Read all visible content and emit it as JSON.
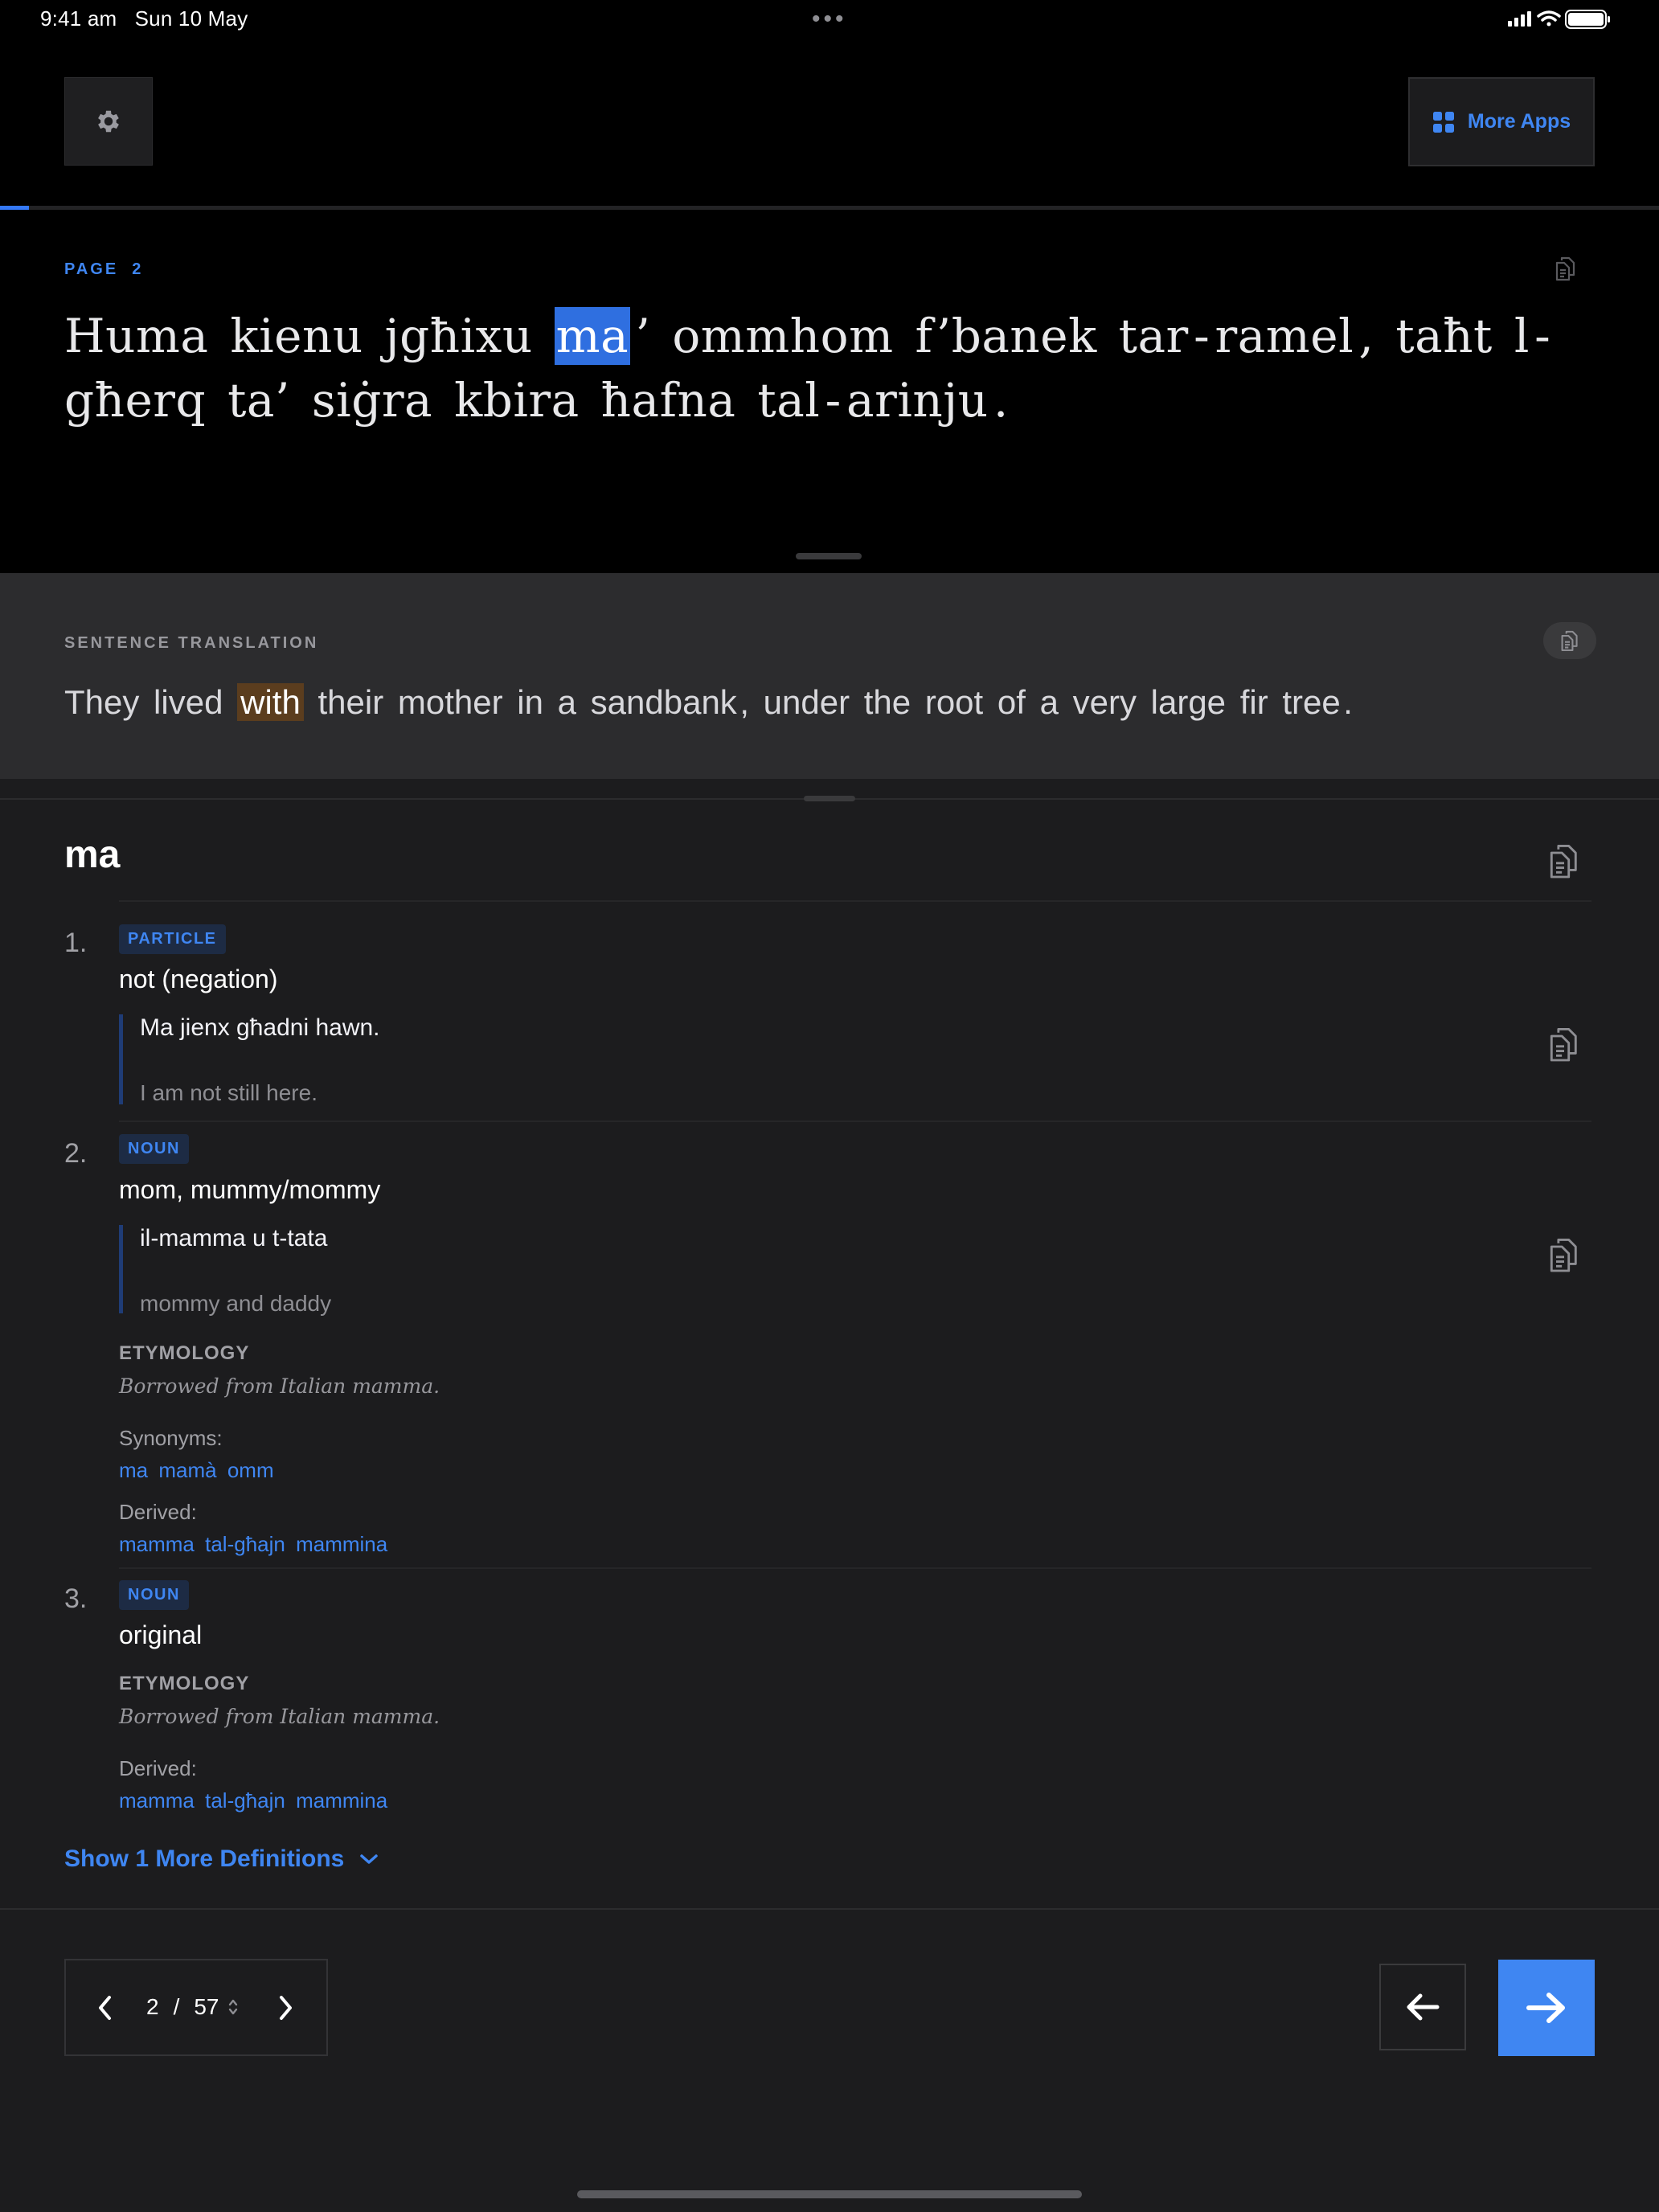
{
  "status_bar": {
    "time": "9:41 am",
    "date": "Sun 10 May",
    "dots": "•••"
  },
  "toolbar": {
    "more_apps_label": "More Apps"
  },
  "reader": {
    "page_label": "PAGE  2",
    "sentence_words": [
      "Huma",
      "kienu",
      "jgħixu",
      "ma",
      "’",
      "ommhom",
      "f’banek",
      "tar",
      "-",
      "ramel",
      ",",
      "taħt",
      "l",
      "-",
      "għerq",
      "ta’",
      "siġra",
      "kbira",
      "ħafna",
      "tal",
      "-",
      "arinju",
      "."
    ],
    "highlighted_word": "ma"
  },
  "translation": {
    "label": "SENTENCE TRANSLATION",
    "words": [
      "They",
      "lived",
      "with",
      "their",
      "mother",
      "in",
      "a",
      "sandbank",
      ",",
      "under",
      "the",
      "root",
      "of",
      "a",
      "very",
      "large",
      "fir",
      "tree",
      "."
    ],
    "highlighted_word": "with"
  },
  "dictionary": {
    "headword": "ma",
    "definitions": [
      {
        "number": "1.",
        "pos": "PARTICLE",
        "gloss": "not (negation)",
        "example": "Ma jienx għadni hawn.",
        "example_translation": "I am not still here."
      },
      {
        "number": "2.",
        "pos": "NOUN",
        "gloss": "mom, mummy/mommy",
        "example": "il-mamma u t-tata",
        "example_translation": "mommy and daddy",
        "etymology_label": "ETYMOLOGY",
        "etymology": "Borrowed from Italian mamma.",
        "synonyms_label": "Synonyms:",
        "synonyms": [
          "ma",
          "mamà",
          "omm"
        ],
        "derived_label": "Derived:",
        "derived": [
          "mamma tal-għajn",
          "mammina"
        ]
      },
      {
        "number": "3.",
        "pos": "NOUN",
        "gloss": "original",
        "etymology_label": "ETYMOLOGY",
        "etymology": "Borrowed from Italian mamma.",
        "derived_label": "Derived:",
        "derived": [
          "mamma tal-għajn",
          "mammina"
        ]
      }
    ],
    "show_more_label": "Show 1 More Definitions"
  },
  "pager": {
    "current": "2",
    "separator": "/",
    "total": "57"
  },
  "icons": {
    "gear": "gear-icon",
    "apps": "grid-icon",
    "copy": "copy-icon",
    "chevron_left": "chevron-left-icon",
    "chevron_right": "chevron-right-icon",
    "chevron_down": "chevron-down-icon",
    "arrow_left": "arrow-left-icon",
    "arrow_right": "arrow-right-icon"
  },
  "colors": {
    "accent": "#3f86f2",
    "highlight_word": "#2f6fe0",
    "highlight_translation": "#5b3d1e",
    "background": "#1c1c1e"
  }
}
